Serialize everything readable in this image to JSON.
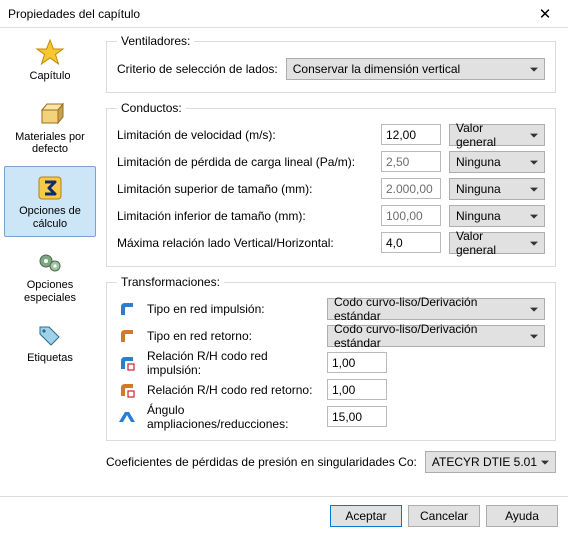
{
  "window": {
    "title": "Propiedades del capítulo"
  },
  "sidebar": {
    "items": [
      {
        "label": "Capítulo"
      },
      {
        "label": "Materiales por defecto"
      },
      {
        "label": "Opciones de cálculo"
      },
      {
        "label": "Opciones especiales"
      },
      {
        "label": "Etiquetas"
      }
    ]
  },
  "groups": {
    "fans": {
      "legend": "Ventiladores:",
      "criteria_label": "Criterio de selección de lados:",
      "criteria_value": "Conservar la dimensión vertical"
    },
    "ducts": {
      "legend": "Conductos:",
      "rows": [
        {
          "label": "Limitación de velocidad (m/s):",
          "value": "12,00",
          "enabled": true,
          "mode": "Valor general"
        },
        {
          "label": "Limitación de pérdida de carga lineal (Pa/m):",
          "value": "2,50",
          "enabled": false,
          "mode": "Ninguna"
        },
        {
          "label": "Limitación superior de tamaño (mm):",
          "value": "2.000,00",
          "enabled": false,
          "mode": "Ninguna"
        },
        {
          "label": "Limitación inferior de tamaño (mm):",
          "value": "100,00",
          "enabled": false,
          "mode": "Ninguna"
        },
        {
          "label": "Máxima relación lado Vertical/Horizontal:",
          "value": "4,0",
          "enabled": true,
          "mode": "Valor general"
        }
      ]
    },
    "transforms": {
      "legend": "Transformaciones:",
      "rows": [
        {
          "kind": "select",
          "icon": "elbow-blue",
          "label": "Tipo en red impulsión:",
          "value": "Codo curvo-liso/Derivación estándar"
        },
        {
          "kind": "select",
          "icon": "elbow-orange",
          "label": "Tipo en red retorno:",
          "value": "Codo curvo-liso/Derivación estándar"
        },
        {
          "kind": "number",
          "icon": "ratio-blue",
          "label": "Relación R/H codo red impulsión:",
          "value": "1,00"
        },
        {
          "kind": "number",
          "icon": "ratio-orange",
          "label": "Relación R/H codo red retorno:",
          "value": "1,00"
        },
        {
          "kind": "number",
          "icon": "angle-blue",
          "label": "Ángulo ampliaciones/reducciones:",
          "value": "15,00"
        }
      ]
    },
    "coef": {
      "label": "Coeficientes de pérdidas de presión en singularidades Co:",
      "value": "ATECYR DTIE 5.01"
    }
  },
  "footer": {
    "ok": "Aceptar",
    "cancel": "Cancelar",
    "help": "Ayuda"
  }
}
